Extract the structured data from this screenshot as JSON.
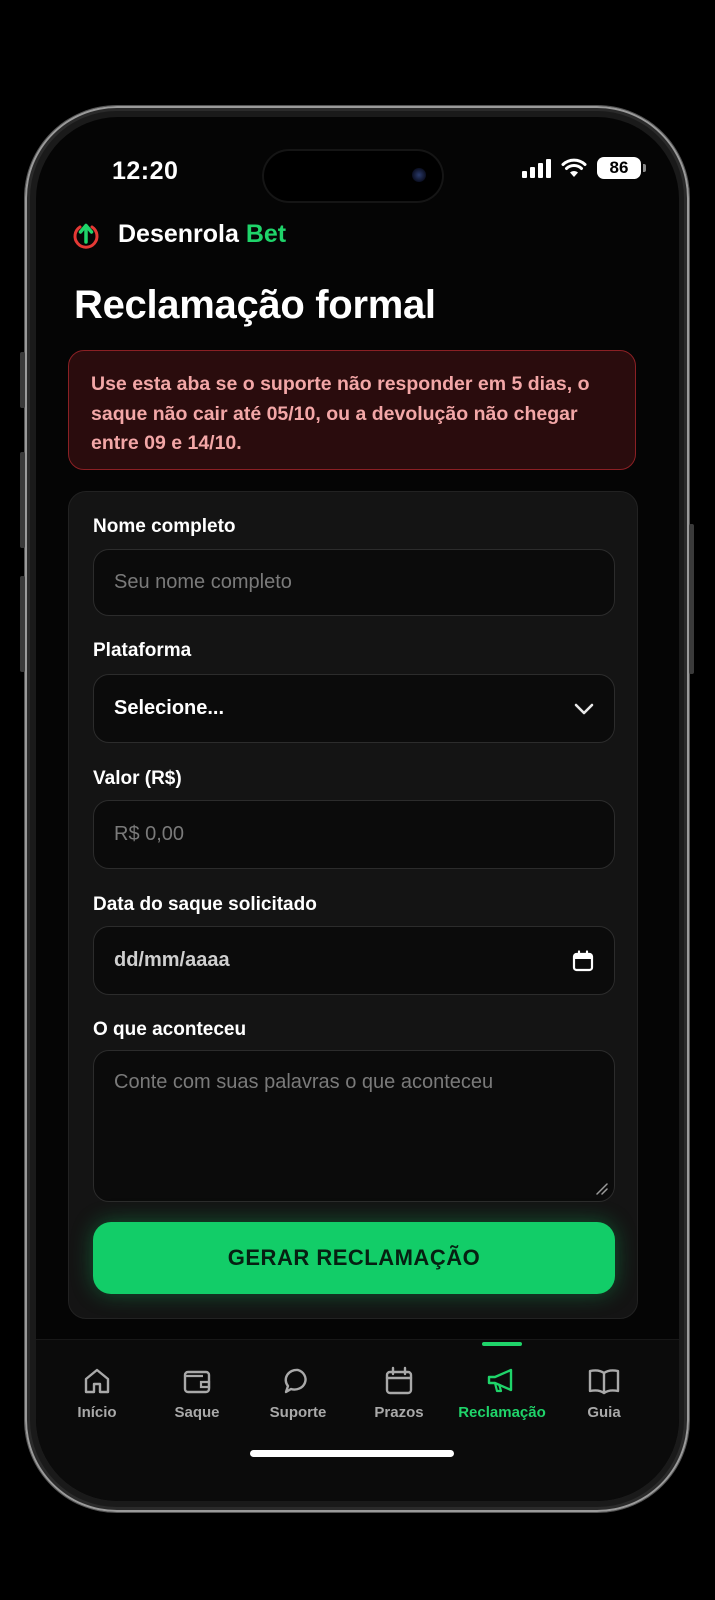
{
  "status_bar": {
    "time": "12:20",
    "battery": "86"
  },
  "brand": {
    "name_main": "Desenrola",
    "name_accent": "Bet",
    "accent_color": "#1fd46a",
    "logo_color": "#e53935",
    "logo_icon": "arrow-up-circle-icon"
  },
  "page": {
    "title": "Reclamação formal"
  },
  "alert": {
    "text": "Use esta aba se o suporte não responder em 5 dias, o saque não cair até 05/10, ou a devolução não chegar entre 09 e 14/10."
  },
  "form": {
    "name": {
      "label": "Nome completo",
      "placeholder": "Seu nome completo"
    },
    "platform": {
      "label": "Plataforma",
      "selected": "Selecione..."
    },
    "amount": {
      "label": "Valor (R$)",
      "placeholder": "R$ 0,00"
    },
    "date": {
      "label": "Data do saque solicitado",
      "placeholder": "dd/mm/aaaa"
    },
    "description": {
      "label": "O que aconteceu",
      "placeholder": "Conte com suas palavras o que aconteceu"
    },
    "submit_label": "GERAR RECLAMAÇÃO",
    "submit_color": "#12cd68"
  },
  "tabs": [
    {
      "label": "Início",
      "icon": "home-icon",
      "active": false
    },
    {
      "label": "Saque",
      "icon": "wallet-icon",
      "active": false
    },
    {
      "label": "Suporte",
      "icon": "chat-bubble-icon",
      "active": false
    },
    {
      "label": "Prazos",
      "icon": "calendar-icon",
      "active": false
    },
    {
      "label": "Reclamação",
      "icon": "megaphone-icon",
      "active": true
    },
    {
      "label": "Guia",
      "icon": "book-icon",
      "active": false
    }
  ]
}
